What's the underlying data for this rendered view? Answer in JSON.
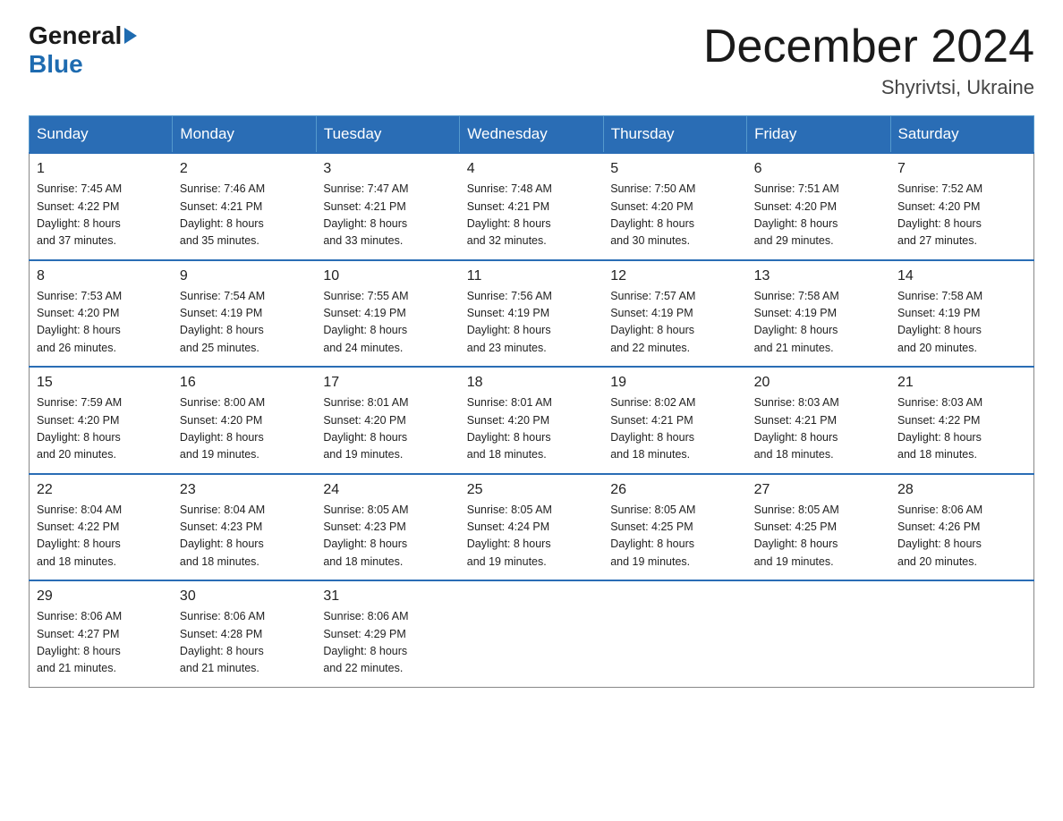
{
  "header": {
    "logo_general": "General",
    "logo_blue": "Blue",
    "title": "December 2024",
    "location": "Shyrivtsi, Ukraine"
  },
  "days_of_week": [
    "Sunday",
    "Monday",
    "Tuesday",
    "Wednesday",
    "Thursday",
    "Friday",
    "Saturday"
  ],
  "weeks": [
    [
      {
        "day": "1",
        "info": "Sunrise: 7:45 AM\nSunset: 4:22 PM\nDaylight: 8 hours\nand 37 minutes."
      },
      {
        "day": "2",
        "info": "Sunrise: 7:46 AM\nSunset: 4:21 PM\nDaylight: 8 hours\nand 35 minutes."
      },
      {
        "day": "3",
        "info": "Sunrise: 7:47 AM\nSunset: 4:21 PM\nDaylight: 8 hours\nand 33 minutes."
      },
      {
        "day": "4",
        "info": "Sunrise: 7:48 AM\nSunset: 4:21 PM\nDaylight: 8 hours\nand 32 minutes."
      },
      {
        "day": "5",
        "info": "Sunrise: 7:50 AM\nSunset: 4:20 PM\nDaylight: 8 hours\nand 30 minutes."
      },
      {
        "day": "6",
        "info": "Sunrise: 7:51 AM\nSunset: 4:20 PM\nDaylight: 8 hours\nand 29 minutes."
      },
      {
        "day": "7",
        "info": "Sunrise: 7:52 AM\nSunset: 4:20 PM\nDaylight: 8 hours\nand 27 minutes."
      }
    ],
    [
      {
        "day": "8",
        "info": "Sunrise: 7:53 AM\nSunset: 4:20 PM\nDaylight: 8 hours\nand 26 minutes."
      },
      {
        "day": "9",
        "info": "Sunrise: 7:54 AM\nSunset: 4:19 PM\nDaylight: 8 hours\nand 25 minutes."
      },
      {
        "day": "10",
        "info": "Sunrise: 7:55 AM\nSunset: 4:19 PM\nDaylight: 8 hours\nand 24 minutes."
      },
      {
        "day": "11",
        "info": "Sunrise: 7:56 AM\nSunset: 4:19 PM\nDaylight: 8 hours\nand 23 minutes."
      },
      {
        "day": "12",
        "info": "Sunrise: 7:57 AM\nSunset: 4:19 PM\nDaylight: 8 hours\nand 22 minutes."
      },
      {
        "day": "13",
        "info": "Sunrise: 7:58 AM\nSunset: 4:19 PM\nDaylight: 8 hours\nand 21 minutes."
      },
      {
        "day": "14",
        "info": "Sunrise: 7:58 AM\nSunset: 4:19 PM\nDaylight: 8 hours\nand 20 minutes."
      }
    ],
    [
      {
        "day": "15",
        "info": "Sunrise: 7:59 AM\nSunset: 4:20 PM\nDaylight: 8 hours\nand 20 minutes."
      },
      {
        "day": "16",
        "info": "Sunrise: 8:00 AM\nSunset: 4:20 PM\nDaylight: 8 hours\nand 19 minutes."
      },
      {
        "day": "17",
        "info": "Sunrise: 8:01 AM\nSunset: 4:20 PM\nDaylight: 8 hours\nand 19 minutes."
      },
      {
        "day": "18",
        "info": "Sunrise: 8:01 AM\nSunset: 4:20 PM\nDaylight: 8 hours\nand 18 minutes."
      },
      {
        "day": "19",
        "info": "Sunrise: 8:02 AM\nSunset: 4:21 PM\nDaylight: 8 hours\nand 18 minutes."
      },
      {
        "day": "20",
        "info": "Sunrise: 8:03 AM\nSunset: 4:21 PM\nDaylight: 8 hours\nand 18 minutes."
      },
      {
        "day": "21",
        "info": "Sunrise: 8:03 AM\nSunset: 4:22 PM\nDaylight: 8 hours\nand 18 minutes."
      }
    ],
    [
      {
        "day": "22",
        "info": "Sunrise: 8:04 AM\nSunset: 4:22 PM\nDaylight: 8 hours\nand 18 minutes."
      },
      {
        "day": "23",
        "info": "Sunrise: 8:04 AM\nSunset: 4:23 PM\nDaylight: 8 hours\nand 18 minutes."
      },
      {
        "day": "24",
        "info": "Sunrise: 8:05 AM\nSunset: 4:23 PM\nDaylight: 8 hours\nand 18 minutes."
      },
      {
        "day": "25",
        "info": "Sunrise: 8:05 AM\nSunset: 4:24 PM\nDaylight: 8 hours\nand 19 minutes."
      },
      {
        "day": "26",
        "info": "Sunrise: 8:05 AM\nSunset: 4:25 PM\nDaylight: 8 hours\nand 19 minutes."
      },
      {
        "day": "27",
        "info": "Sunrise: 8:05 AM\nSunset: 4:25 PM\nDaylight: 8 hours\nand 19 minutes."
      },
      {
        "day": "28",
        "info": "Sunrise: 8:06 AM\nSunset: 4:26 PM\nDaylight: 8 hours\nand 20 minutes."
      }
    ],
    [
      {
        "day": "29",
        "info": "Sunrise: 8:06 AM\nSunset: 4:27 PM\nDaylight: 8 hours\nand 21 minutes."
      },
      {
        "day": "30",
        "info": "Sunrise: 8:06 AM\nSunset: 4:28 PM\nDaylight: 8 hours\nand 21 minutes."
      },
      {
        "day": "31",
        "info": "Sunrise: 8:06 AM\nSunset: 4:29 PM\nDaylight: 8 hours\nand 22 minutes."
      },
      {
        "day": "",
        "info": ""
      },
      {
        "day": "",
        "info": ""
      },
      {
        "day": "",
        "info": ""
      },
      {
        "day": "",
        "info": ""
      }
    ]
  ]
}
